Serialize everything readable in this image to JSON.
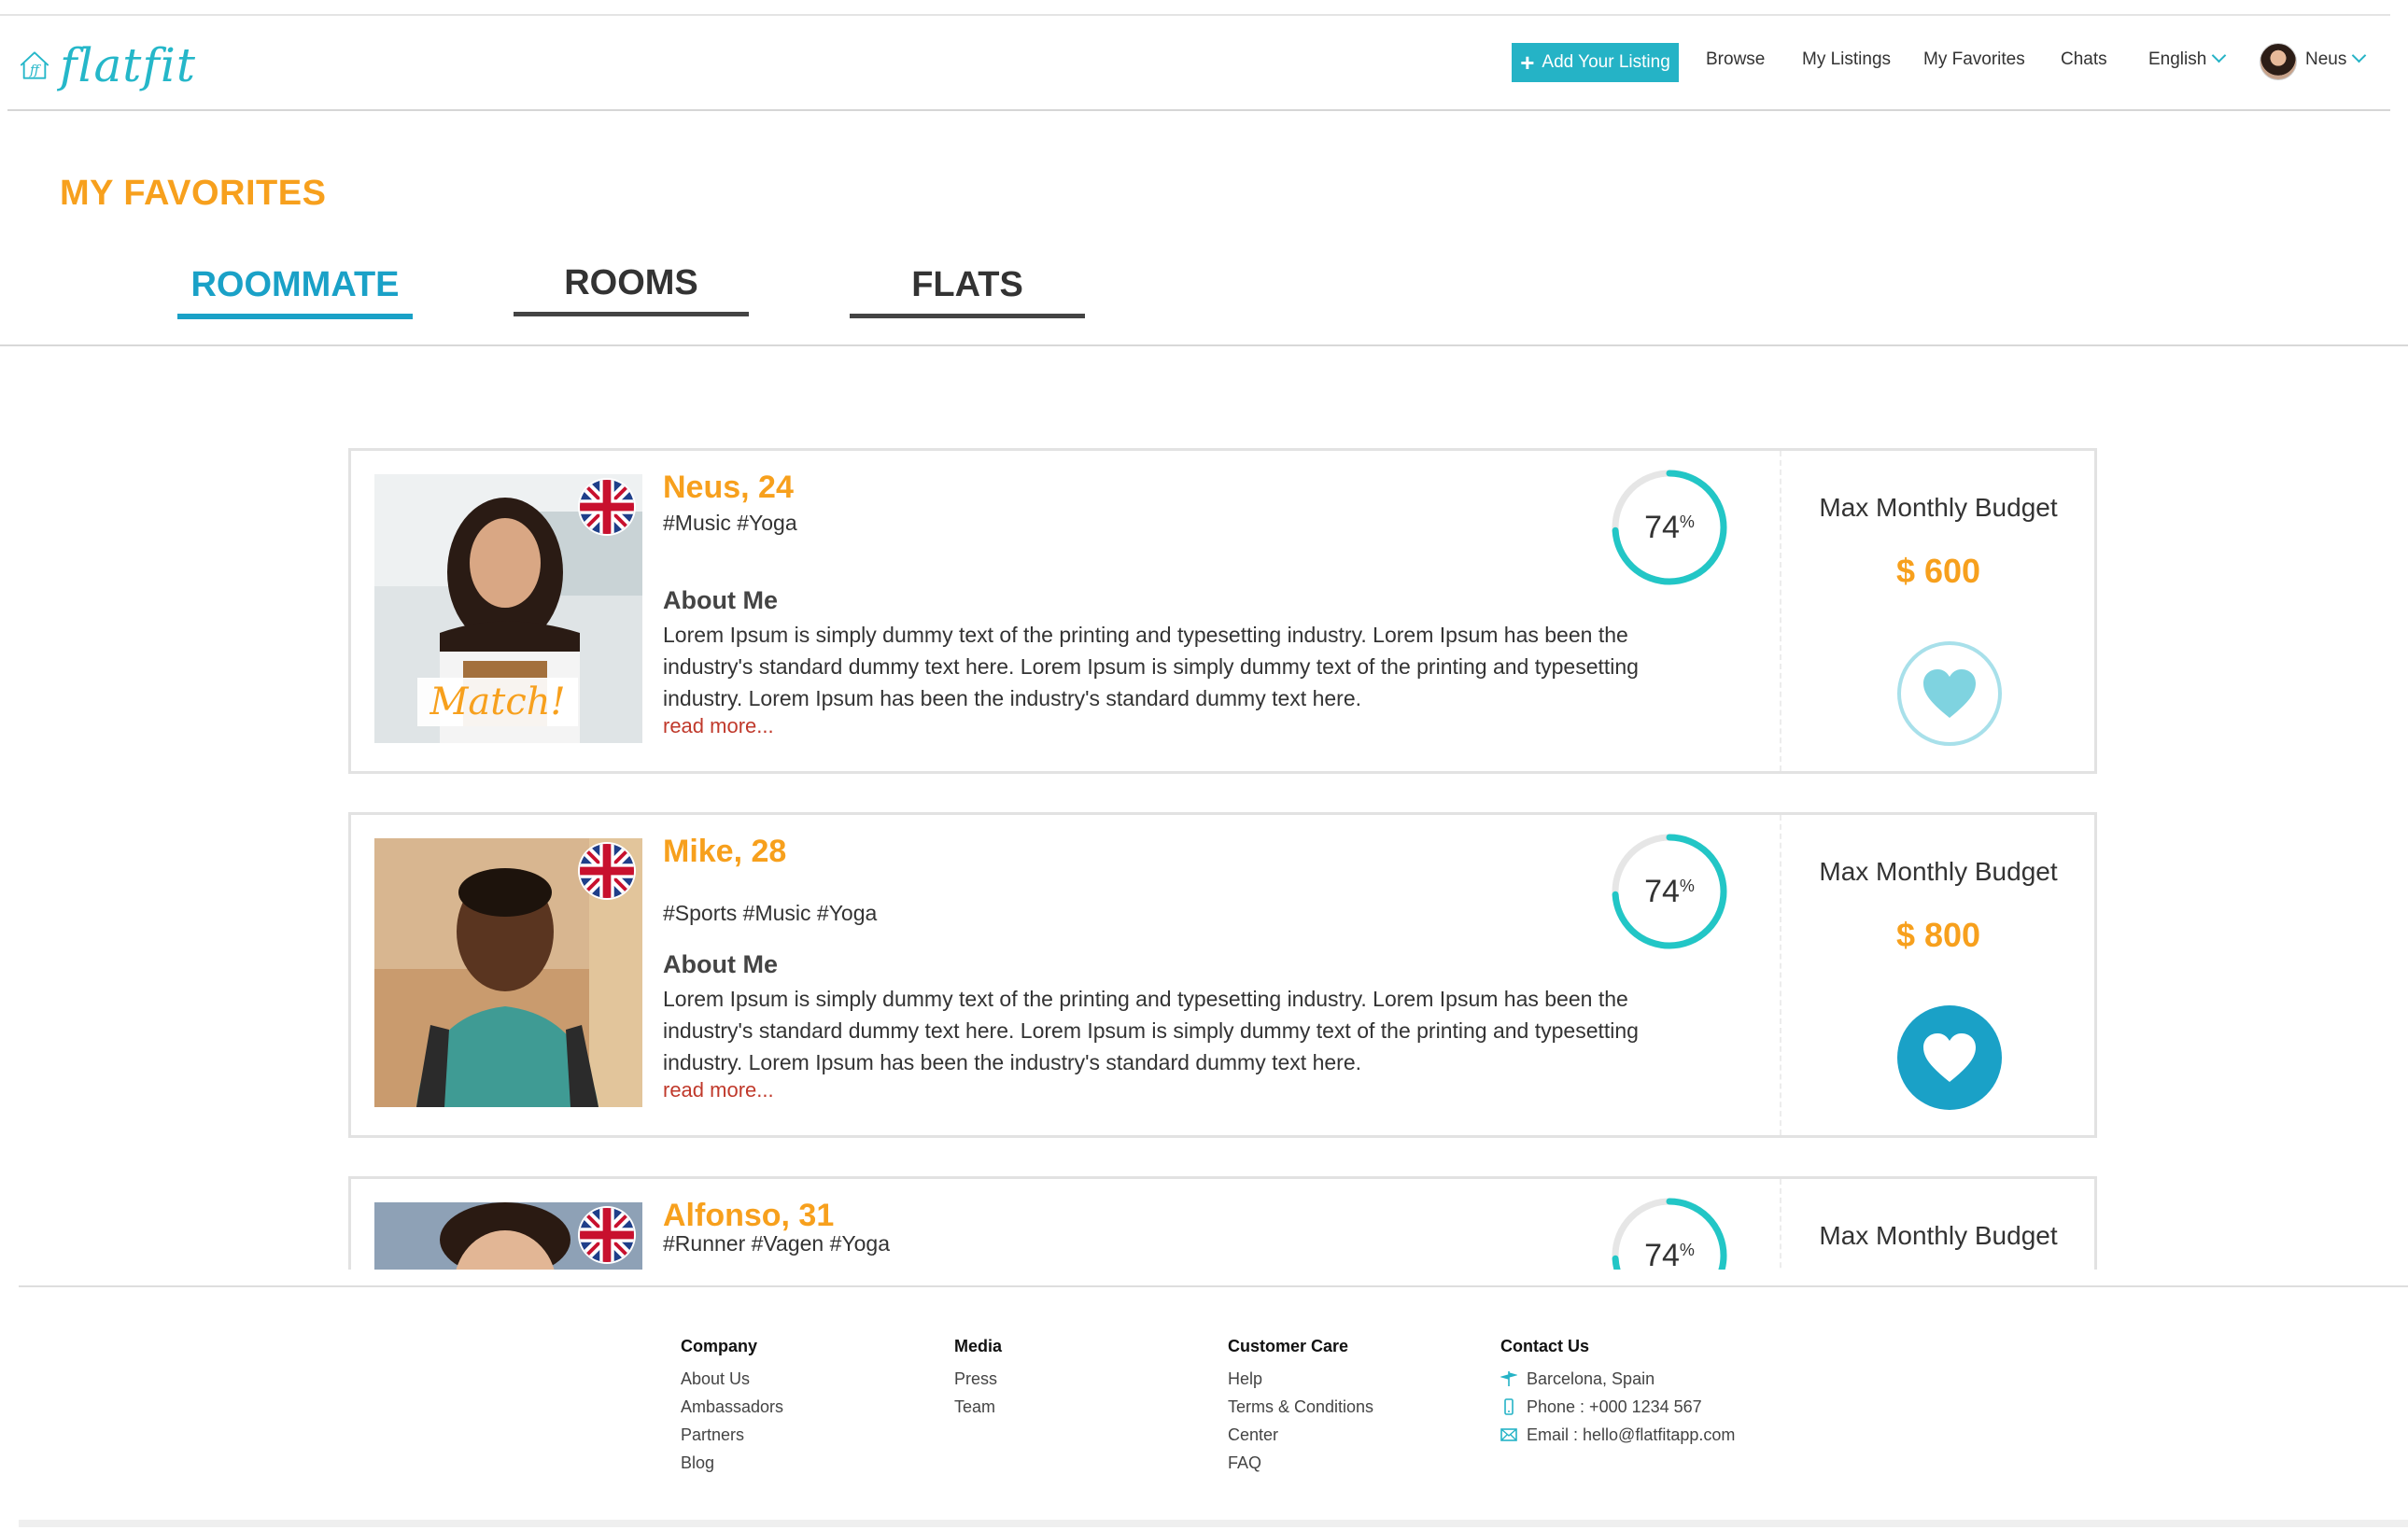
{
  "header": {
    "logo_text": "flatfit",
    "add_listing_label": "Add Your Listing",
    "nav": {
      "browse": "Browse",
      "my_listings": "My Listings",
      "my_favorites": "My Favorites",
      "chats": "Chats",
      "language": "English",
      "user": "Neus"
    }
  },
  "page": {
    "title": "MY FAVORITES",
    "tabs": [
      {
        "label": "ROOMMATE",
        "active": true
      },
      {
        "label": "ROOMS",
        "active": false
      },
      {
        "label": "FLATS",
        "active": false
      }
    ]
  },
  "cards": [
    {
      "name": "Neus, 24",
      "tags": "#Music #Yoga",
      "match_badge": "Match!",
      "about_title": "About Me",
      "about_text": "Lorem Ipsum is simply dummy text of the printing and typesetting industry. Lorem Ipsum has been the industry's standard dummy text here. Lorem Ipsum is simply dummy text of the printing and typesetting industry. Lorem Ipsum has been the industry's standard dummy text here.",
      "read_more": "read more...",
      "match_percent": "74",
      "percent_sign": "%",
      "budget_label": "Max Monthly Budget",
      "budget_value": "$ 600",
      "favorited": false
    },
    {
      "name": "Mike, 28",
      "tags": "#Sports #Music #Yoga",
      "about_title": "About Me",
      "about_text": "Lorem Ipsum is simply dummy text of the printing and typesetting industry. Lorem Ipsum has been the industry's standard dummy text here. Lorem Ipsum is simply dummy text of the printing and typesetting industry. Lorem Ipsum has been the industry's standard dummy text here.",
      "read_more": "read more...",
      "match_percent": "74",
      "percent_sign": "%",
      "budget_label": "Max Monthly Budget",
      "budget_value": "$ 800",
      "favorited": true
    },
    {
      "name": "Alfonso, 31",
      "tags": "#Runner #Vagen #Yoga",
      "match_percent": "74",
      "percent_sign": "%",
      "budget_label": "Max Monthly Budget"
    }
  ],
  "footer": {
    "company": {
      "title": "Company",
      "links": [
        "About Us",
        "Ambassadors",
        "Partners",
        "Blog"
      ]
    },
    "media": {
      "title": "Media",
      "links": [
        "Press",
        "Team"
      ]
    },
    "customer_care": {
      "title": "Customer Care",
      "links": [
        "Help",
        "Terms & Conditions",
        "Center",
        "FAQ"
      ]
    },
    "contact": {
      "title": "Contact Us",
      "location": "Barcelona, Spain",
      "phone": "Phone : +000 1234 567",
      "email": "Email : hello@flatfitapp.com"
    }
  },
  "colors": {
    "accent": "#25b3c6",
    "orange": "#f7a01d",
    "tab_active": "#1aa1c7",
    "read_more": "#c0392b",
    "heart_outline": "#a8e0ea"
  },
  "icons": [
    "house-logo-icon",
    "plus-icon",
    "chevron-down-icon",
    "uk-flag-icon",
    "heart-icon",
    "location-icon",
    "phone-icon",
    "email-icon"
  ]
}
